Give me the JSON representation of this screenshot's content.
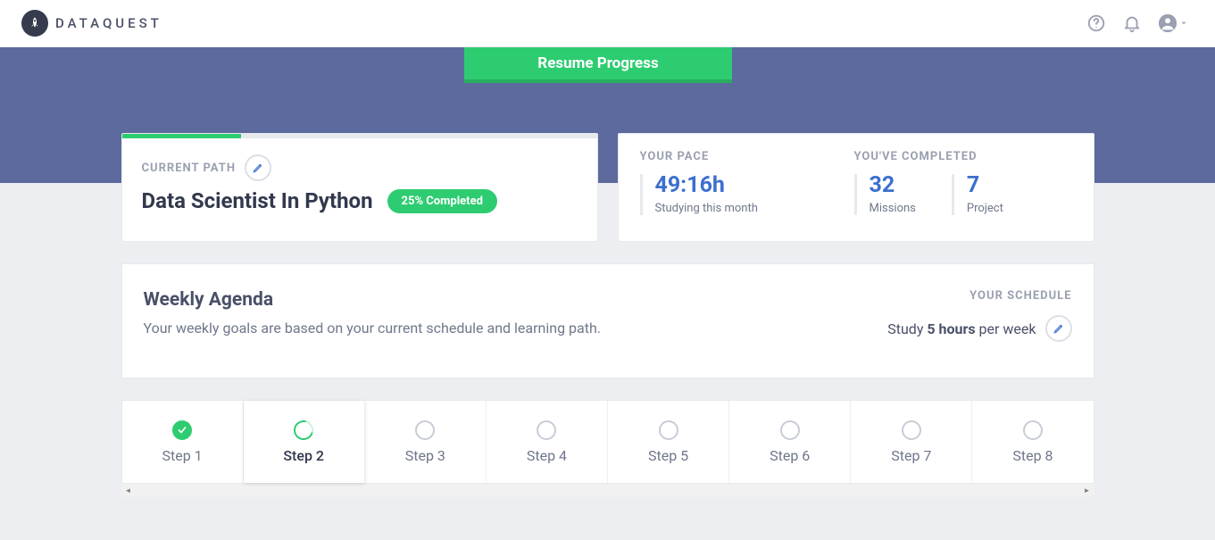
{
  "brand": {
    "name": "DATAQUEST"
  },
  "resume_button": "Resume Progress",
  "path": {
    "label": "CURRENT PATH",
    "title": "Data Scientist In Python",
    "pill": "25% Completed",
    "progress_pct": 25
  },
  "pace": {
    "label": "YOUR PACE",
    "value": "49:16h",
    "sub": "Studying this month"
  },
  "completed": {
    "label": "YOU'VE COMPLETED",
    "missions_value": "32",
    "missions_sub": "Missions",
    "project_value": "7",
    "project_sub": "Project"
  },
  "agenda": {
    "title": "Weekly Agenda",
    "sub": "Your weekly goals are based on your current schedule and learning path."
  },
  "schedule": {
    "label": "YOUR SCHEDULE",
    "prefix": "Study ",
    "bold": "5 hours",
    "suffix": " per week"
  },
  "steps": [
    {
      "label": "Step 1",
      "state": "done"
    },
    {
      "label": "Step 2",
      "state": "active"
    },
    {
      "label": "Step 3",
      "state": "todo"
    },
    {
      "label": "Step 4",
      "state": "todo"
    },
    {
      "label": "Step 5",
      "state": "todo"
    },
    {
      "label": "Step 6",
      "state": "todo"
    },
    {
      "label": "Step 7",
      "state": "todo"
    },
    {
      "label": "Step 8",
      "state": "todo"
    }
  ]
}
